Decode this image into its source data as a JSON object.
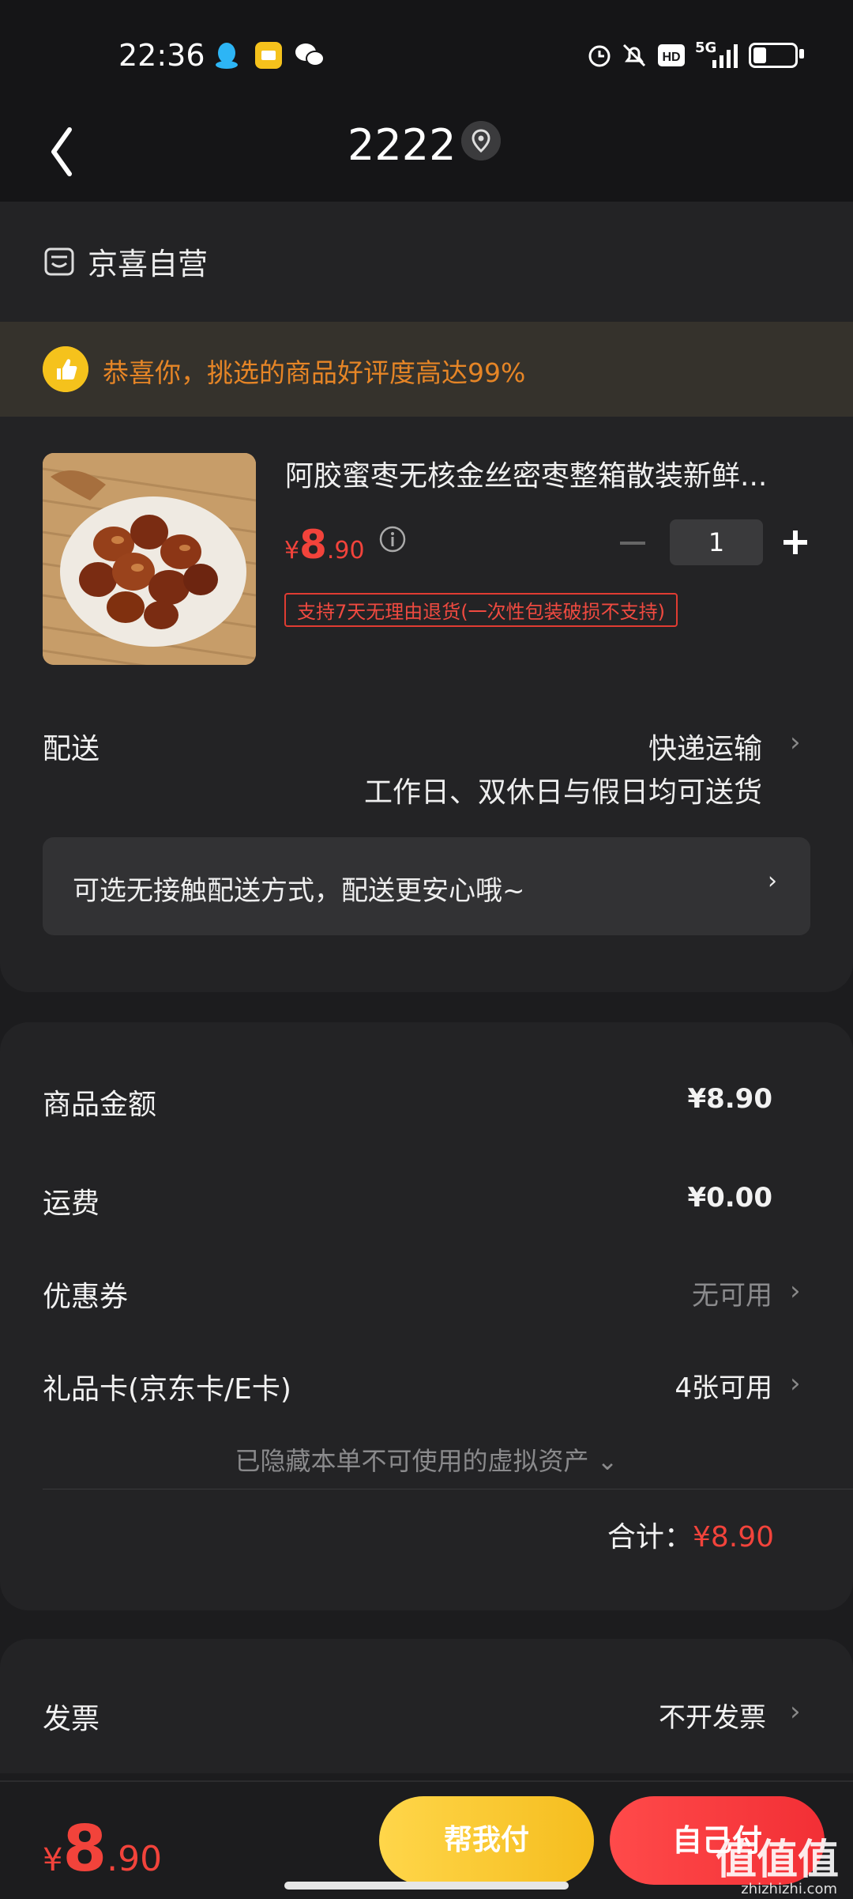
{
  "status_bar": {
    "time": "22:36",
    "network": "5G",
    "icons": [
      "qq-icon",
      "notes-app-icon",
      "wechat-icon",
      "alarm-icon",
      "bell-muted-icon",
      "hd-icon",
      "signal-icon",
      "battery-icon"
    ]
  },
  "header": {
    "title": "2222",
    "back_icon": "back-chevron-icon",
    "location_icon": "location-pin-icon"
  },
  "shop": {
    "name": "京喜自营"
  },
  "notice": {
    "text": "恭喜你，挑选的商品好评度高达99%",
    "color": "#e68526"
  },
  "product": {
    "name": "阿胶蜜枣无核金丝密枣整箱散装新鲜...",
    "price_currency": "¥",
    "price_int": "8",
    "price_dec": ".90",
    "quantity": "1",
    "tag": "支持7天无理由退货(一次性包装破损不支持)"
  },
  "shipping": {
    "label": "配送",
    "method": "快递运输",
    "detail": "工作日、双休日与假日均可送货",
    "contactless": "可选无接触配送方式，配送更安心哦~"
  },
  "summary": {
    "rows": [
      {
        "label": "商品金额",
        "value": "¥8.90"
      },
      {
        "label": "运费",
        "value": "¥0.00"
      },
      {
        "label": "优惠券",
        "value": "无可用"
      },
      {
        "label": "礼品卡(京东卡/E卡)",
        "value": "4张可用"
      }
    ],
    "hidden_assets": "已隐藏本单不可使用的虚拟资产 ⌄",
    "total_label": "合计：",
    "total_value": "¥8.90"
  },
  "invoice": {
    "label": "发票",
    "value": "不开发票"
  },
  "bottom_bar": {
    "price_currency": "¥",
    "price_int": "8",
    "price_dec": ".90",
    "help_pay": "帮我付",
    "self_pay": "自己付",
    "watermark": "值值值",
    "watermark_sub": "zhizhizhi.com"
  },
  "colors": {
    "accent_red": "#f2433b",
    "accent_yellow": "#f5c21c",
    "background": "#1c1c1e"
  }
}
